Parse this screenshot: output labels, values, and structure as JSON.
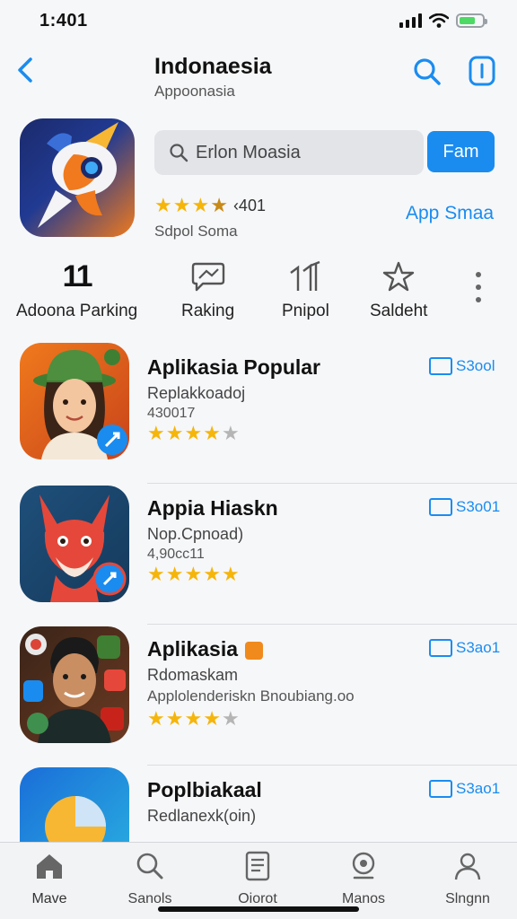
{
  "status": {
    "time": "1:401"
  },
  "header": {
    "title": "Indonaesia",
    "subtitle": "Appoonasia"
  },
  "featured": {
    "search_text": "Erlon Moasia",
    "primary_button": "Fam",
    "rating_count": "‹401",
    "subtitle": "Sdpol Soma",
    "link": "App Smaa",
    "stars": 3.5
  },
  "categories": [
    {
      "label": "Adoona Parking",
      "icon": "11"
    },
    {
      "label": "Raking",
      "icon": "chat-icon"
    },
    {
      "label": "Pnipol",
      "icon": "chart-icon"
    },
    {
      "label": "Saldeht",
      "icon": "star-outline-icon"
    }
  ],
  "apps": [
    {
      "name": "Aplikasia Popular",
      "line1": "Replakkoadoj",
      "line2": "430017",
      "stars": 4,
      "action": "S3ool"
    },
    {
      "name": "Appia Hiaskn",
      "line1": "Nop.Cpnoad)",
      "line2": "4,90cc11",
      "stars": 5,
      "action": "S3o01"
    },
    {
      "name": "Aplikasia",
      "line1": "Rdomaskam",
      "line2": "Applolenderiskn Bnoubiang.oo",
      "stars": 4,
      "action": "S3ao1"
    },
    {
      "name": "Poplbiakaal",
      "line1": "Redlanexk(oin)",
      "line2": "",
      "stars": 0,
      "action": "S3ao1"
    }
  ],
  "tabs": [
    {
      "label": "Mave",
      "icon": "home-icon"
    },
    {
      "label": "Sanols",
      "icon": "search-icon"
    },
    {
      "label": "Oiorot",
      "icon": "document-icon"
    },
    {
      "label": "Manos",
      "icon": "podcast-icon"
    },
    {
      "label": "Slngnn",
      "icon": "profile-icon"
    }
  ],
  "colors": {
    "accent": "#1a8cf0",
    "star": "#f5b50a",
    "battery": "#4cd964"
  }
}
